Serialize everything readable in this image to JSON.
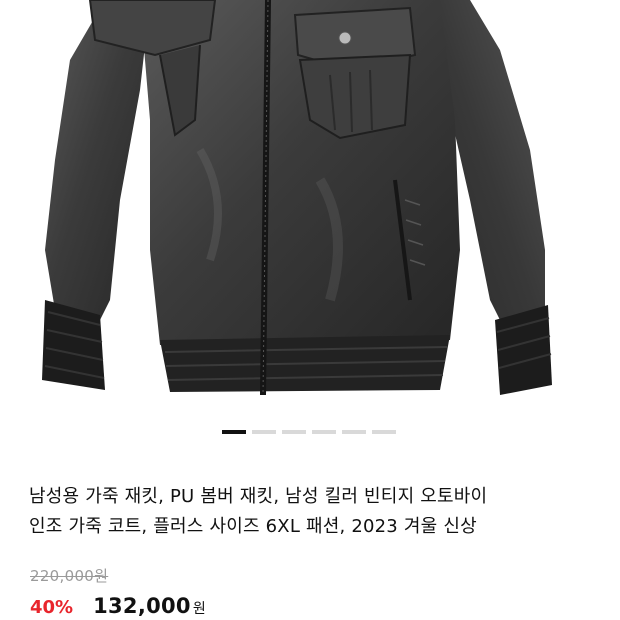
{
  "product": {
    "image_alt_icon": "leather-jacket-image",
    "title_line1": "남성용 가죽 재킷, PU 봄버 재킷, 남성 킬러 빈티지 오토바이",
    "title_line2": "인조 가죽 코트, 플러스 사이즈 6XL 패션, 2023 겨울 신상",
    "original_price": "220,000원",
    "discount": "40%",
    "sale_price": "132,000",
    "currency": "원"
  },
  "carousel": {
    "slide_count": 6,
    "active_index": 0
  },
  "colors": {
    "discount_red": "#e8252c",
    "text": "#111111",
    "muted": "#9a9a9a",
    "dot_inactive": "#d9d9d9",
    "dot_active": "#111111"
  }
}
